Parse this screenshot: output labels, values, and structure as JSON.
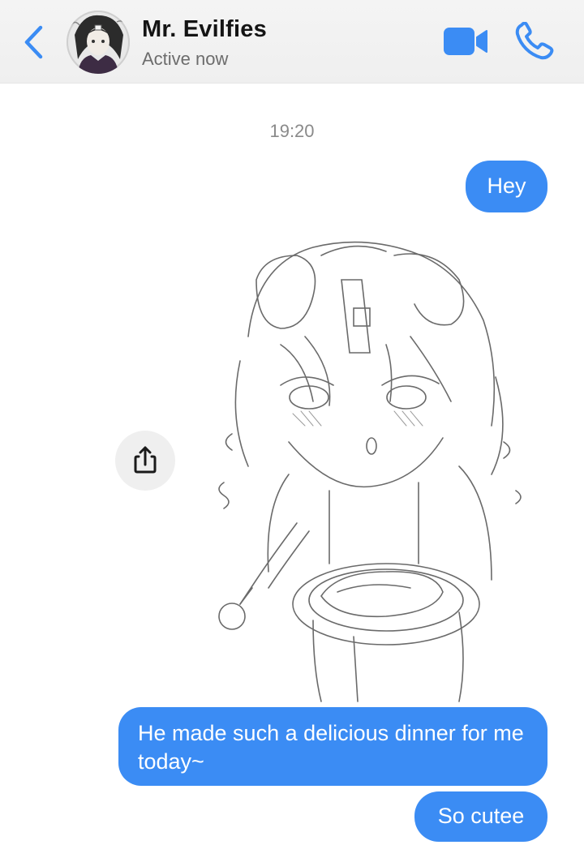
{
  "header": {
    "contact_name": "Mr. Evilfies",
    "status": "Active now"
  },
  "chat": {
    "timestamp": "19:20",
    "messages": [
      {
        "text": "Hey",
        "sender": "me"
      },
      {
        "type": "image",
        "sender": "me"
      },
      {
        "text": "He made such a delicious dinner for me today~",
        "sender": "me"
      },
      {
        "text": "So cutee",
        "sender": "me"
      }
    ]
  },
  "icons": {
    "back": "chevron-left-icon",
    "video": "video-camera-icon",
    "call": "phone-icon",
    "share": "share-icon"
  },
  "colors": {
    "accent": "#3b8cf4",
    "header_bg": "#f2f2f2",
    "bubble_text": "#ffffff"
  }
}
